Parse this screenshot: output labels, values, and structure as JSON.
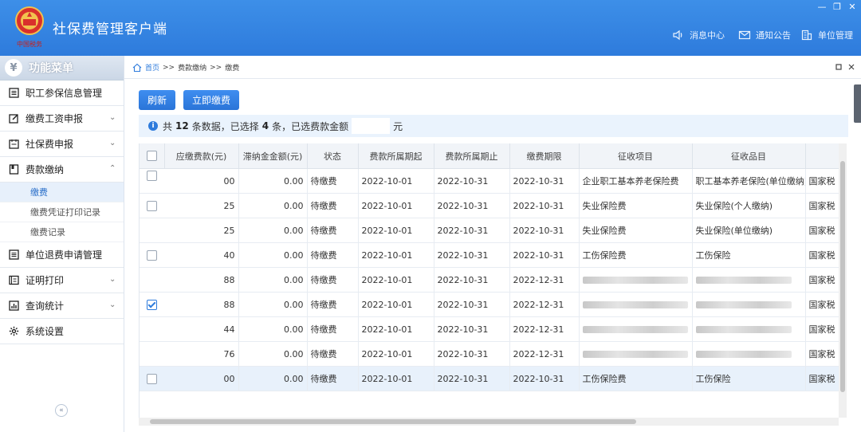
{
  "app": {
    "title": "社保费管理客户端",
    "logo_text": "中国税务",
    "header_links": [
      {
        "label": "消息中心",
        "icon": "speaker-icon"
      },
      {
        "label": "通知公告",
        "icon": "mail-icon"
      },
      {
        "label": "单位管理",
        "icon": "building-icon"
      }
    ],
    "window_controls": [
      "—",
      "❐",
      "✕"
    ]
  },
  "sidebar": {
    "title": "功能菜单",
    "items": [
      {
        "label": "职工参保信息管理",
        "icon": "list-icon",
        "chevron": ""
      },
      {
        "label": "缴费工资申报",
        "icon": "edit-icon",
        "chevron": "⌄"
      },
      {
        "label": "社保费申报",
        "icon": "calendar-icon",
        "chevron": "⌄"
      },
      {
        "label": "费款缴纳",
        "icon": "book-icon",
        "chevron": "⌃"
      }
    ],
    "subitems": [
      {
        "label": "缴费",
        "active": true
      },
      {
        "label": "缴费凭证打印记录",
        "active": false
      },
      {
        "label": "缴费记录",
        "active": false
      }
    ],
    "items_after": [
      {
        "label": "单位退费申请管理",
        "icon": "list-icon",
        "chevron": ""
      },
      {
        "label": "证明打印",
        "icon": "print-icon",
        "chevron": "⌄"
      },
      {
        "label": "查询统计",
        "icon": "chart-icon",
        "chevron": "⌄"
      },
      {
        "label": "系统设置",
        "icon": "gear-icon",
        "chevron": ""
      }
    ],
    "collapse_label": "«"
  },
  "breadcrumb": {
    "home": "首页",
    "sep": ">>",
    "level1": "费款缴纳",
    "level2": "缴费"
  },
  "toolbar": {
    "refresh_label": "刷新",
    "pay_label": "立即缴费"
  },
  "summary": {
    "prefix": "共",
    "total": "12",
    "mid": "条数据，已选择",
    "selected": "4",
    "suffix": "条，已选费款金额",
    "unit": "元"
  },
  "table": {
    "headers": [
      "应缴费款(元)",
      "滞纳金金额(元)",
      "状态",
      "费款所属期起",
      "费款所属期止",
      "缴费期限",
      "征收项目",
      "征收品目",
      ""
    ],
    "rows": [
      {
        "checked": false,
        "amount": "00",
        "late": "0.00",
        "status": "待缴费",
        "start": "2022-10-01",
        "end": "2022-10-31",
        "deadline": "2022-10-31",
        "item": "企业职工基本养老保险费",
        "subitem": "职工基本养老保险(单位缴纳)",
        "org": "国家税",
        "blurred": false,
        "highlight": false,
        "show_cb": "partial"
      },
      {
        "checked": false,
        "amount": "25",
        "late": "0.00",
        "status": "待缴费",
        "start": "2022-10-01",
        "end": "2022-10-31",
        "deadline": "2022-10-31",
        "item": "失业保险费",
        "subitem": "失业保险(个人缴纳)",
        "org": "国家税",
        "blurred": false,
        "highlight": false,
        "show_cb": "yes"
      },
      {
        "checked": false,
        "amount": "25",
        "late": "0.00",
        "status": "待缴费",
        "start": "2022-10-01",
        "end": "2022-10-31",
        "deadline": "2022-10-31",
        "item": "失业保险费",
        "subitem": "失业保险(单位缴纳)",
        "org": "国家税",
        "blurred": false,
        "highlight": false,
        "show_cb": "no"
      },
      {
        "checked": false,
        "amount": "40",
        "late": "0.00",
        "status": "待缴费",
        "start": "2022-10-01",
        "end": "2022-10-31",
        "deadline": "2022-10-31",
        "item": "工伤保险费",
        "subitem": "工伤保险",
        "org": "国家税",
        "blurred": false,
        "highlight": false,
        "show_cb": "yes"
      },
      {
        "checked": false,
        "amount": "88",
        "late": "0.00",
        "status": "待缴费",
        "start": "2022-10-01",
        "end": "2022-10-31",
        "deadline": "2022-12-31",
        "item": "",
        "subitem": "",
        "org": "国家税",
        "blurred": true,
        "highlight": false,
        "show_cb": "no"
      },
      {
        "checked": true,
        "amount": "88",
        "late": "0.00",
        "status": "待缴费",
        "start": "2022-10-01",
        "end": "2022-10-31",
        "deadline": "2022-12-31",
        "item": "",
        "subitem": "",
        "org": "国家税",
        "blurred": true,
        "highlight": false,
        "show_cb": "yes"
      },
      {
        "checked": false,
        "amount": "44",
        "late": "0.00",
        "status": "待缴费",
        "start": "2022-10-01",
        "end": "2022-10-31",
        "deadline": "2022-12-31",
        "item": "",
        "subitem": "",
        "org": "国家税",
        "blurred": true,
        "highlight": false,
        "show_cb": "no"
      },
      {
        "checked": false,
        "amount": "76",
        "late": "0.00",
        "status": "待缴费",
        "start": "2022-10-01",
        "end": "2022-10-31",
        "deadline": "2022-12-31",
        "item": "",
        "subitem": "",
        "org": "国家税",
        "blurred": true,
        "highlight": false,
        "show_cb": "no"
      },
      {
        "checked": false,
        "amount": "00",
        "late": "0.00",
        "status": "待缴费",
        "start": "2022-10-01",
        "end": "2022-10-31",
        "deadline": "2022-10-31",
        "item": "工伤保险费",
        "subitem": "工伤保险",
        "org": "国家税",
        "blurred": false,
        "highlight": true,
        "show_cb": "yes"
      }
    ]
  },
  "colors": {
    "header_blue": "#2e7bdc",
    "accent": "#2e7bdc",
    "highlight_row": "#e8f1fb"
  }
}
